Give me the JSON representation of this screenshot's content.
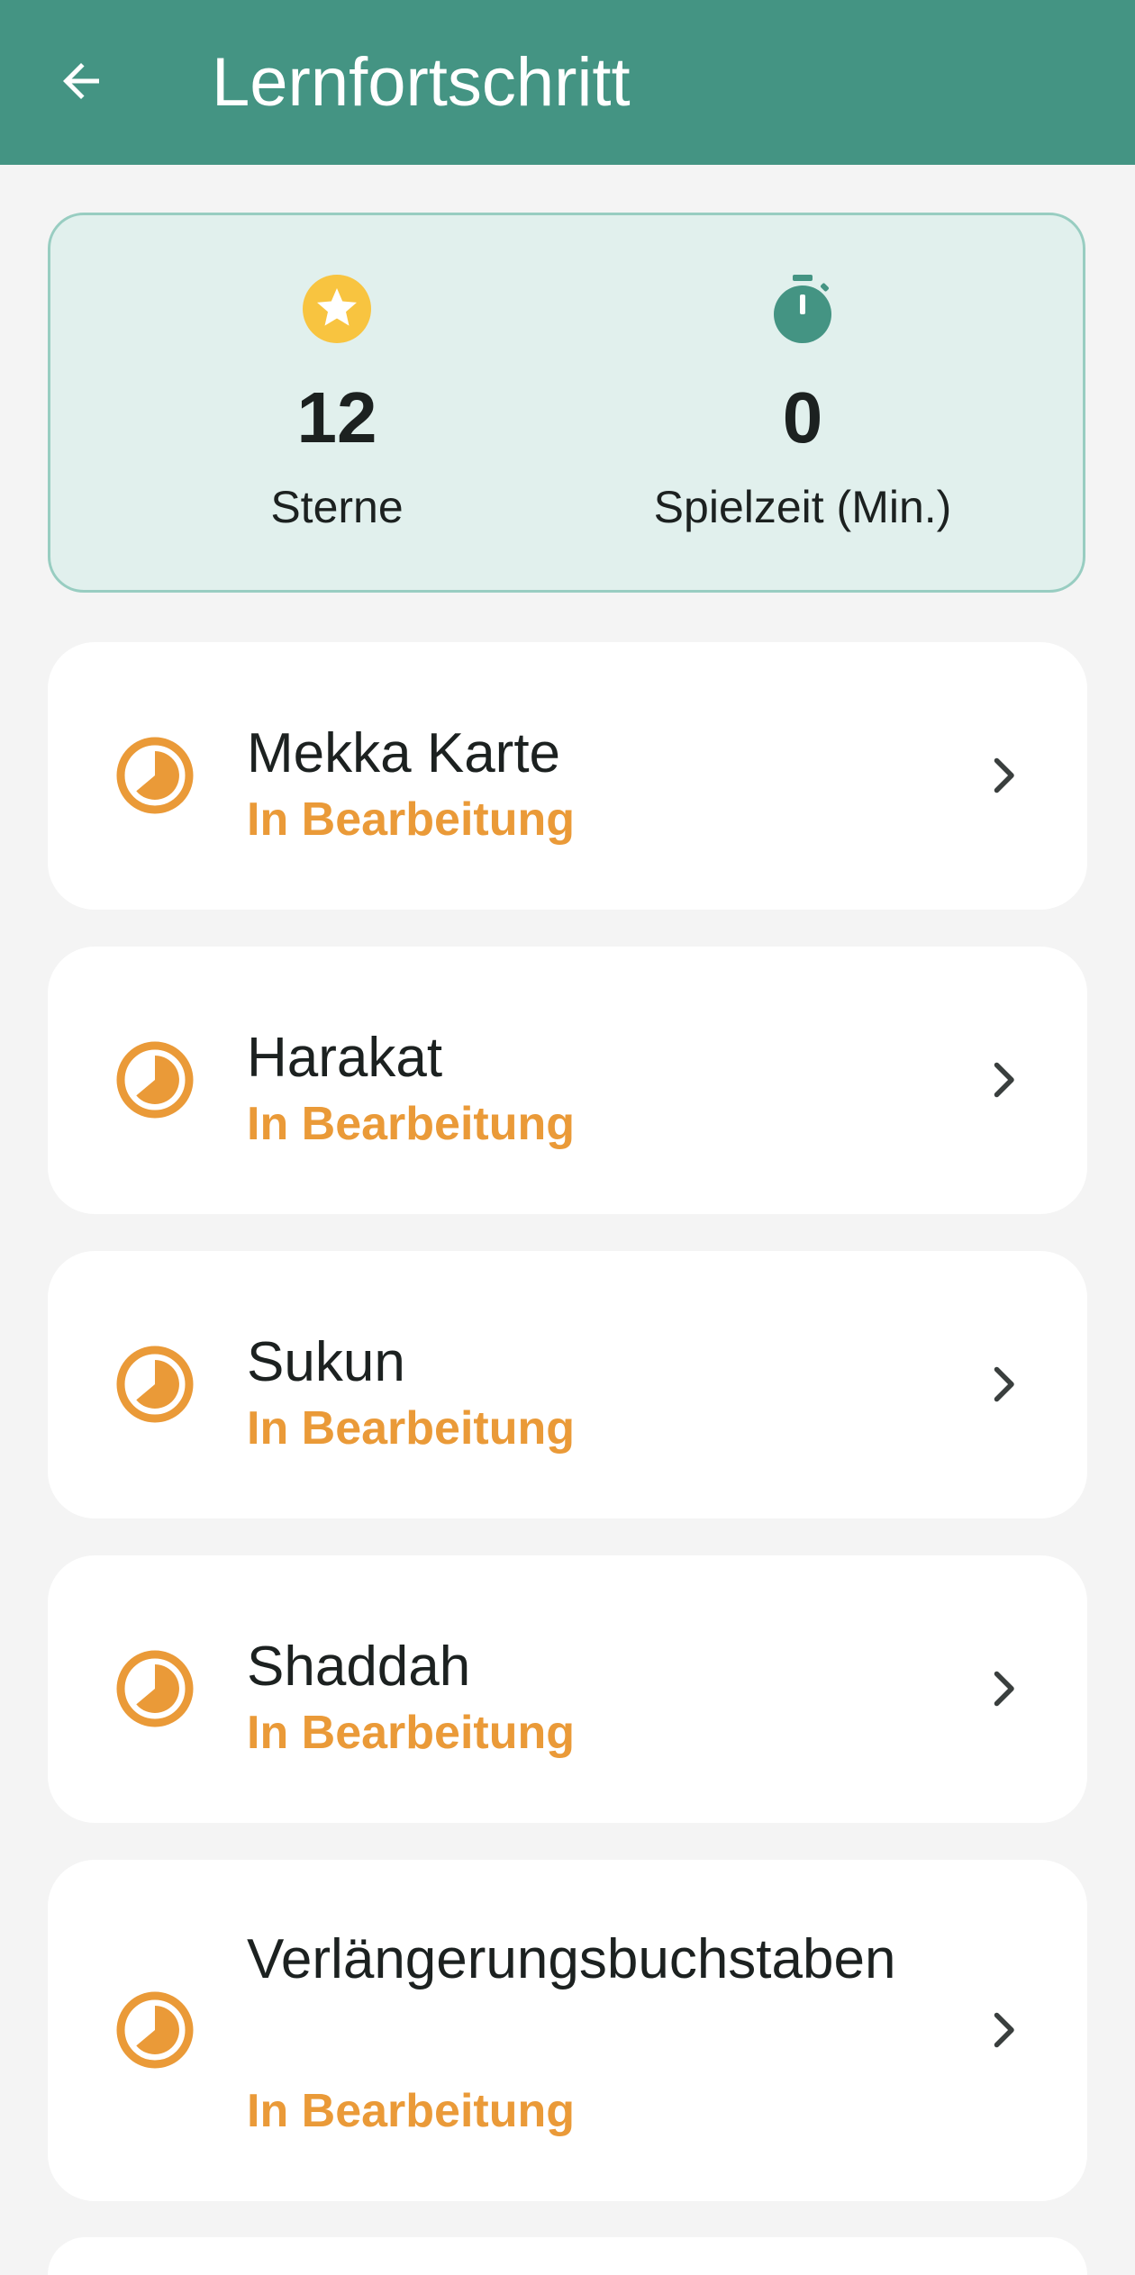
{
  "app_bar": {
    "title": "Lernfortschritt",
    "back_icon": "arrow-left-icon",
    "background": "#449483"
  },
  "stats": {
    "stars": {
      "value": "12",
      "label": "Sterne",
      "icon": "star-icon"
    },
    "playtime": {
      "value": "0",
      "label": "Spielzeit (Min.)",
      "icon": "stopwatch-icon"
    }
  },
  "items": [
    {
      "title": "Mekka Karte",
      "status": "In Bearbeitung"
    },
    {
      "title": "Harakat",
      "status": "In Bearbeitung"
    },
    {
      "title": "Sukun",
      "status": "In Bearbeitung"
    },
    {
      "title": "Shaddah",
      "status": "In Bearbeitung"
    },
    {
      "title": "Verlängerungsbuchstaben",
      "status": "In Bearbeitung"
    }
  ],
  "colors": {
    "accent": "#449483",
    "status_in_progress": "#ea9a38",
    "star": "#f8c440"
  }
}
